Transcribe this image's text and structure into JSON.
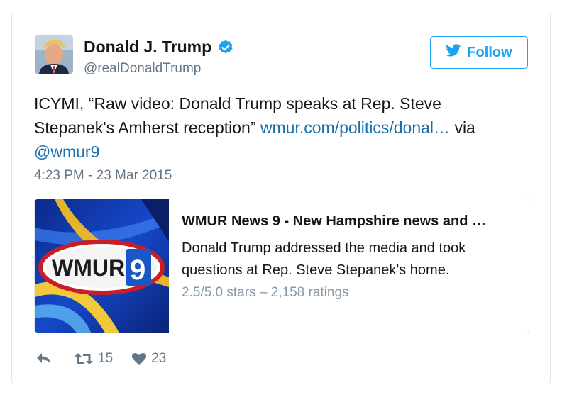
{
  "user": {
    "name": "Donald J. Trump",
    "handle": "@realDonaldTrump",
    "verified": true
  },
  "follow_button": {
    "label": "Follow"
  },
  "tweet": {
    "text_prefix": "ICYMI, “Raw video: Donald Trump speaks at Rep. Steve Stepanek's Amherst reception”",
    "link_text": "wmur.com/politics/donal…",
    "via_text": "via",
    "mention": "@wmur9",
    "timestamp": "4:23 PM - 23 Mar 2015"
  },
  "card": {
    "logo_text": "WMUR",
    "logo_number": "9",
    "title": "WMUR News 9 - New Hampshire news and …",
    "description": "Donald Trump addressed the media and took questions at Rep. Steve Stepanek's home.",
    "rating": "2.5/5.0 stars – 2,158 ratings"
  },
  "actions": {
    "retweets": "15",
    "likes": "23"
  },
  "colors": {
    "accent": "#1da1f2",
    "link": "#1b6fa8",
    "muted": "#657786",
    "border": "#e1e8ed"
  }
}
